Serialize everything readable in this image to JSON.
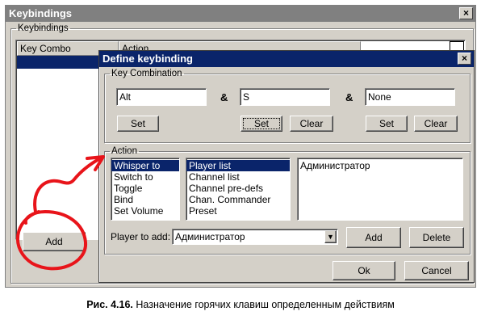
{
  "outer_window": {
    "title": "Keybindings",
    "close_glyph": "×",
    "group_label": "Keybindings",
    "columns": [
      "Key Combo",
      "Action"
    ],
    "add_button": "Add"
  },
  "dialog": {
    "title": "Define keybinding",
    "close_glyph": "×",
    "key_combination": {
      "label": "Key Combination",
      "key1": "Alt",
      "key2": "S",
      "key3": "None",
      "amp": "&",
      "set_label": "Set",
      "clear_label": "Clear"
    },
    "action": {
      "label": "Action",
      "actions": [
        "Whisper to",
        "Switch to",
        "Toggle",
        "Bind",
        "Set Volume"
      ],
      "selected_action": 0,
      "targets": [
        "Player list",
        "Channel list",
        "Channel pre-defs",
        "Chan. Commander",
        "Preset"
      ],
      "selected_target": 0,
      "assigned": [
        "Администратор"
      ],
      "player_to_add_label": "Player to add:",
      "player_to_add_value": "Администратор",
      "add_label": "Add",
      "delete_label": "Delete"
    },
    "ok_label": "Ok",
    "cancel_label": "Cancel"
  },
  "caption": {
    "number": "Рис. 4.16.",
    "text": " Назначение горячих клавиш определенным действиям"
  },
  "colors": {
    "face": "#d4d0c8",
    "active_title": "#0a246a",
    "inactive_title": "#808080",
    "selection": "#0a246a",
    "annotation": "#e8141a"
  }
}
